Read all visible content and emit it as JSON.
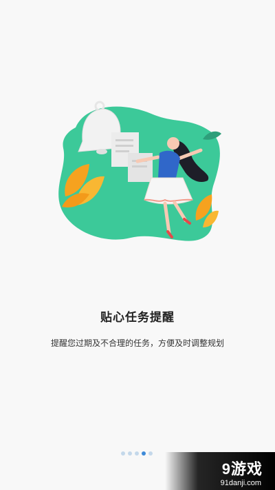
{
  "onboarding": {
    "title": "贴心任务提醒",
    "subtitle": "提醒您过期及不合理的任务，方便及时调整规划",
    "pager": {
      "count": 5,
      "active_index": 3
    },
    "illustration": {
      "icons": [
        "bell-icon",
        "document-icon",
        "leaf-icon",
        "dancing-woman"
      ]
    }
  },
  "watermark": {
    "logo": "9游戏",
    "url": "91danji.com"
  },
  "colors": {
    "accent": "#3cc999",
    "dot_inactive": "#c4d8ea",
    "dot_active": "#3e8ad8",
    "leaf": "#f6a21f"
  }
}
